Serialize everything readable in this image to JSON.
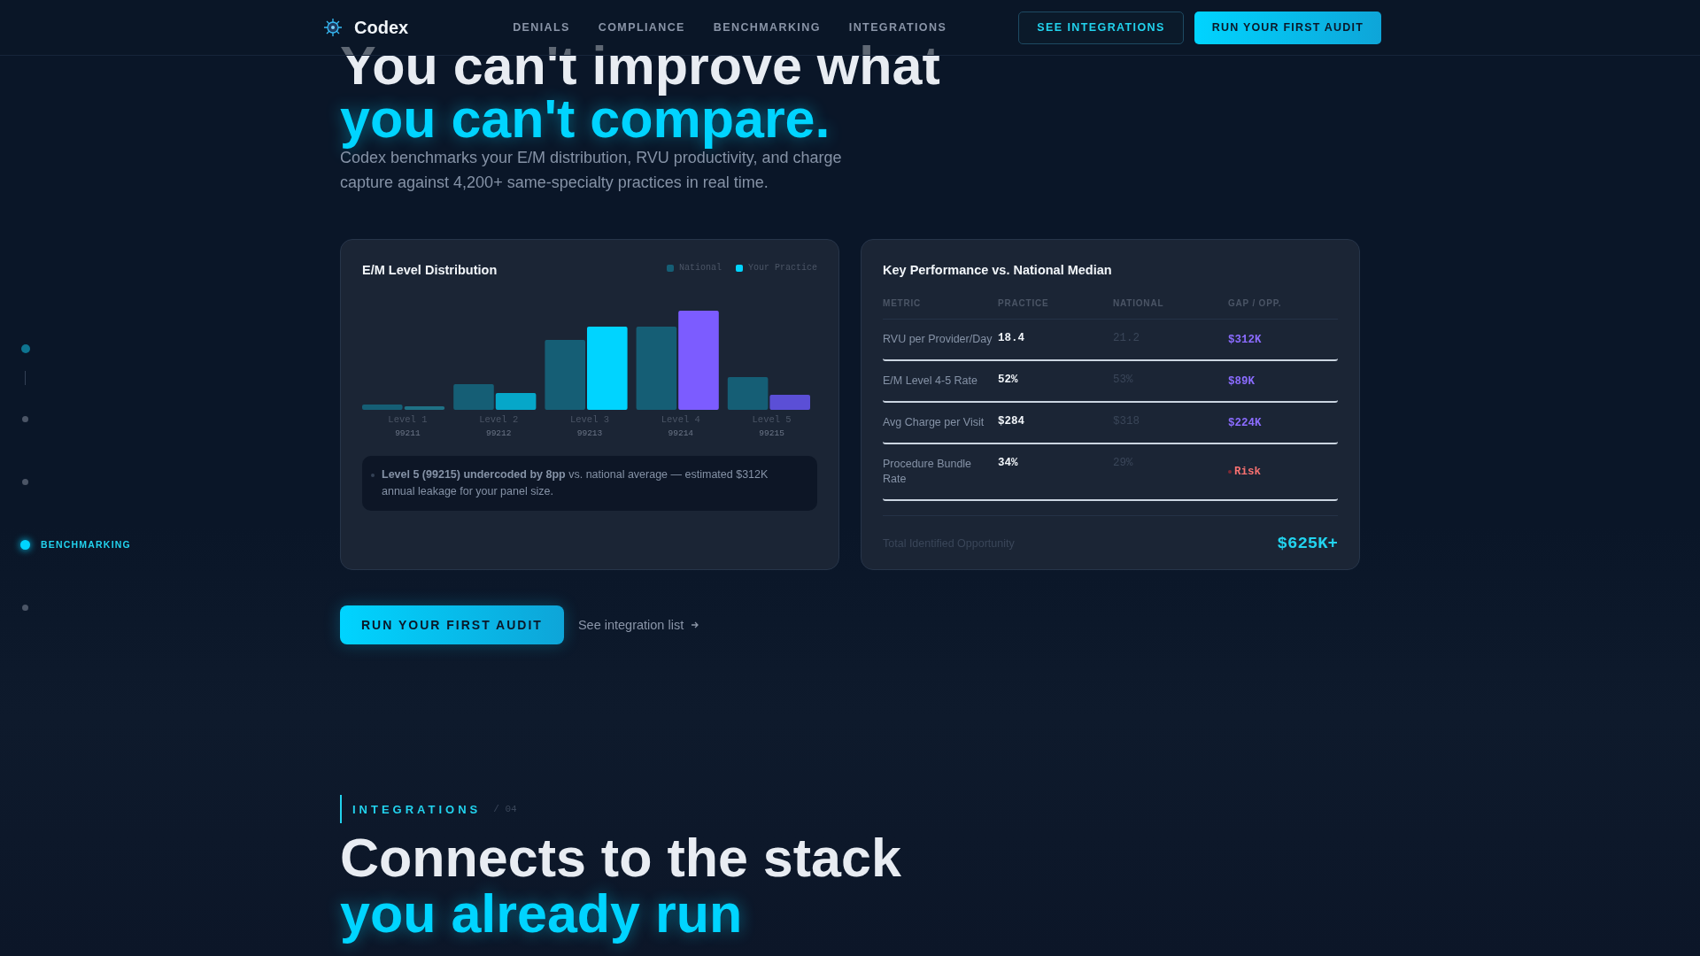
{
  "header": {
    "brand": "Codex",
    "nav": [
      {
        "label": "DENIALS"
      },
      {
        "label": "COMPLIANCE"
      },
      {
        "label": "BENCHMARKING"
      },
      {
        "label": "INTEGRATIONS"
      }
    ],
    "secondary_button": "SEE INTEGRATIONS",
    "primary_button": "RUN YOUR FIRST AUDIT"
  },
  "side_nav": [
    {
      "visited": true,
      "selected": false
    },
    {
      "visited": false,
      "selected": false
    },
    {
      "visited": false,
      "selected": false
    },
    {
      "label": "BENCHMARKING",
      "visited": false,
      "selected": true
    },
    {
      "visited": false,
      "selected": false
    }
  ],
  "hero": {
    "title_line_1": "You can't improve what",
    "title_line_2": "you can't compare.",
    "description": "Codex benchmarks your E/M distribution, RVU productivity, and charge capture against 4,200+ same-specialty practices in real time."
  },
  "chart_card": {
    "title": "E/M Level Distribution",
    "legend": [
      {
        "label": "National",
        "color": "#155e75"
      },
      {
        "label": "Your Practice",
        "color": "#00d4ff"
      }
    ],
    "categories": [
      {
        "label": "Level 1",
        "code": "99211"
      },
      {
        "label": "Level 2",
        "code": "99212"
      },
      {
        "label": "Level 3",
        "code": "99213"
      },
      {
        "label": "Level 4",
        "code": "99214"
      },
      {
        "label": "Level 5",
        "code": "99215"
      }
    ],
    "insight": "**Level 5 (99215) undercoded by 8pp** vs. national average — estimated $312K annual leakage for your panel size."
  },
  "kpi_card": {
    "title": "Key Performance vs. National Median",
    "columns": [
      "METRIC",
      "PRACTICE",
      "NATIONAL",
      "GAP / OPP."
    ],
    "rows": [
      {
        "metric": "RVU per Provider/Day",
        "practice": "18.4",
        "national": "21.2",
        "gap": "$312K",
        "kind": "amount"
      },
      {
        "metric": "E/M Level 4-5 Rate",
        "practice": "52%",
        "national": "53%",
        "gap": "$89K",
        "kind": "amount"
      },
      {
        "metric": "Avg Charge per Visit",
        "practice": "$284",
        "national": "$318",
        "gap": "$224K",
        "kind": "amount"
      },
      {
        "metric": "Procedure Bundle Rate",
        "practice": "34%",
        "national": "29%",
        "gap": "Risk",
        "kind": "risk"
      }
    ],
    "total_label": "Total Identified Opportunity",
    "total_value": "$625K+"
  },
  "cta": {
    "button": "RUN YOUR FIRST AUDIT",
    "link": "See integration list"
  },
  "next_section": {
    "eyebrow": "INTEGRATIONS",
    "number": "/ 04",
    "title_line_1": "Connects to the stack",
    "title_line_2": "you already run"
  }
}
